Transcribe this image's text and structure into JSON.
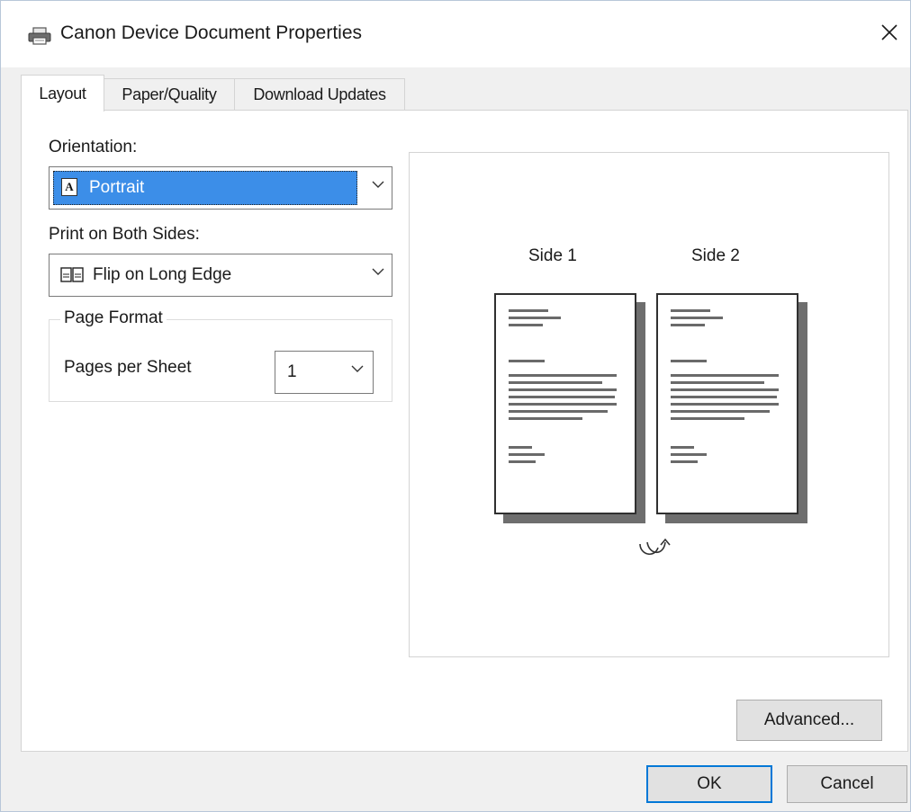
{
  "window": {
    "title": "Canon Device Document Properties"
  },
  "tabs": [
    {
      "label": "Layout",
      "active": true
    },
    {
      "label": "Paper/Quality",
      "active": false
    },
    {
      "label": "Download Updates",
      "active": false
    }
  ],
  "layout": {
    "orientation_label": "Orientation:",
    "orientation_value": "Portrait",
    "both_sides_label": "Print on Both Sides:",
    "both_sides_value": "Flip on Long Edge",
    "page_format_title": "Page Format",
    "pages_per_sheet_label": "Pages per Sheet",
    "pages_per_sheet_value": "1"
  },
  "preview": {
    "side1_label": "Side 1",
    "side2_label": "Side 2"
  },
  "buttons": {
    "advanced": "Advanced...",
    "ok": "OK",
    "cancel": "Cancel"
  },
  "icons": [
    "printer-icon",
    "close-icon",
    "portrait-icon",
    "flip-long-edge-icon",
    "chevron-down-icon",
    "flip-rotate-icon"
  ],
  "colors": {
    "selection": "#3c8ee8",
    "default_button_border": "#0078d7",
    "window_bg": "#f0f0f0"
  }
}
